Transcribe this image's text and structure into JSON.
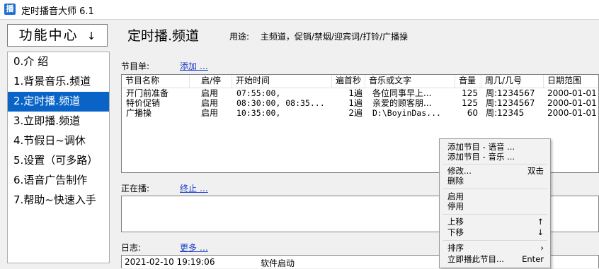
{
  "window": {
    "title": "定时播音大师 6.1",
    "icon_glyph": "播"
  },
  "sidebar": {
    "function_center": "功能中心",
    "arrow": "↓",
    "items": [
      {
        "label": "0.介 绍"
      },
      {
        "label": "1.背景音乐.频道"
      },
      {
        "label": "2.定时播.频道"
      },
      {
        "label": "3.立即播.频道"
      },
      {
        "label": "4.节假日~调休"
      },
      {
        "label": "5.设置（可多路）"
      },
      {
        "label": "6.语音广告制作"
      },
      {
        "label": "7.帮助~快速入手"
      }
    ],
    "selected_index": 2,
    "selected_color": "#0a64c8"
  },
  "main": {
    "title": "定时播.频道",
    "usage_label": "用途:",
    "usage_text": "主频道，促销/禁烟/迎宾词/打铃/广播操",
    "program_list_label": "节目单:",
    "add_link": "添加 …",
    "playing_label": "正在播:",
    "stop_link": "终止 …",
    "log_label": "日志:",
    "more_link": "更多 …"
  },
  "table": {
    "headers": [
      "节目名称",
      "启/停",
      "开始时间",
      "遍首秒",
      "音乐或文字",
      "音量",
      "周几/几号",
      "日期范围"
    ],
    "rows": [
      [
        "开门前准备",
        "启用",
        "07:55:00,",
        "1遍",
        "各位同事早上...",
        "125",
        "周:1234567",
        "2000-01-01"
      ],
      [
        "特价促销",
        "启用",
        "08:30:00, 08:35...",
        "1遍",
        "亲爱的顾客朋...",
        "125",
        "周:1234567",
        "2000-01-01"
      ],
      [
        "广播操",
        "启用",
        "10:35:00,",
        "2遍",
        "D:\\BoyinDas...",
        "60",
        "周:12345",
        "2000-01-01"
      ]
    ]
  },
  "log": {
    "entries": [
      {
        "time": "2021-02-10  19:19:06",
        "message": "软件启动"
      }
    ]
  },
  "context_menu": {
    "items": [
      {
        "label": "添加节目 - 语音 ...",
        "shortcut": ""
      },
      {
        "label": "添加节目 - 音乐 ...",
        "shortcut": ""
      },
      {
        "label": "修改...",
        "shortcut": "双击"
      },
      {
        "label": "删除",
        "shortcut": ""
      },
      {
        "label": "启用",
        "shortcut": ""
      },
      {
        "label": "停用",
        "shortcut": ""
      },
      {
        "label": "上移",
        "shortcut": "↑"
      },
      {
        "label": "下移",
        "shortcut": "↓"
      },
      {
        "label": "排序",
        "shortcut": "›"
      },
      {
        "label": "立即播此节目...",
        "shortcut": "Enter"
      }
    ]
  }
}
